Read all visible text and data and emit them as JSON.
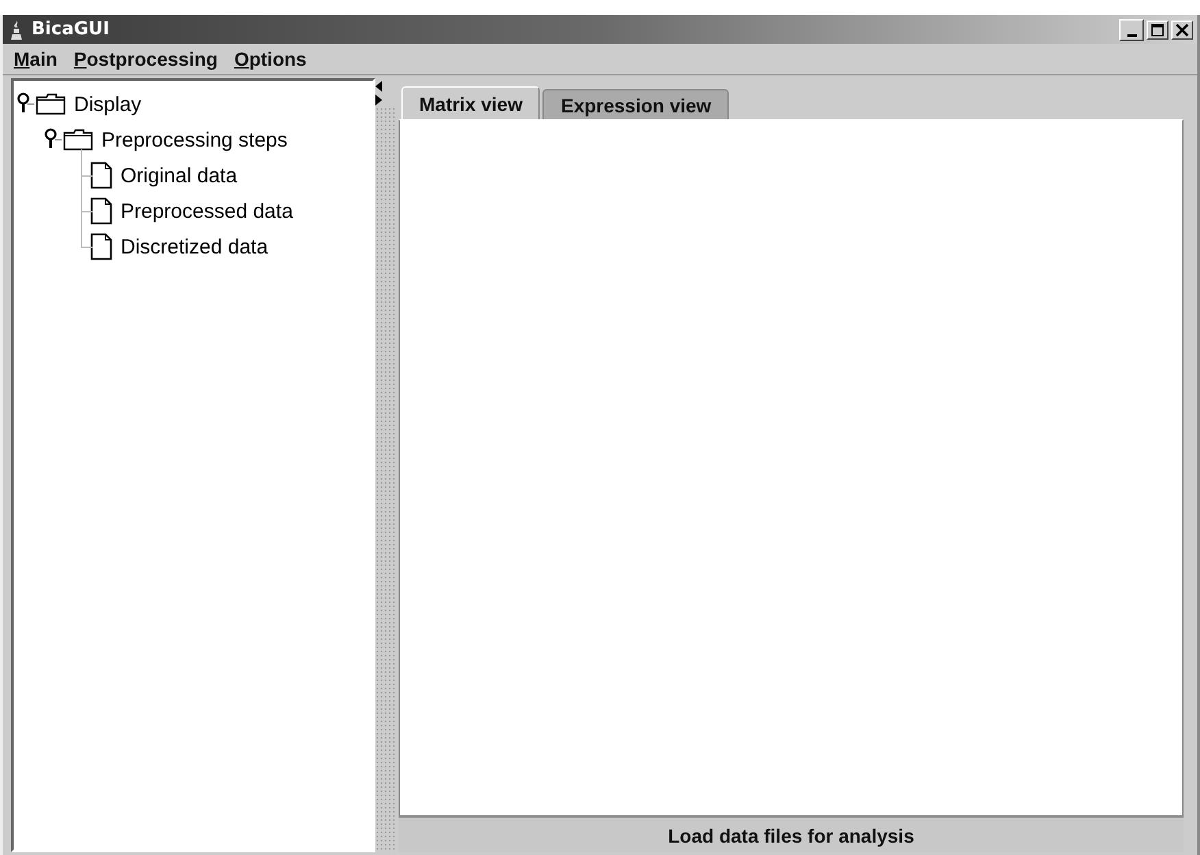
{
  "window": {
    "title": "BicaGUI"
  },
  "menu": [
    "Main",
    "Postprocessing",
    "Options"
  ],
  "tree": [
    {
      "label": "Display",
      "kind": "folder",
      "expanded": true,
      "children": [
        {
          "label": "Preprocessing steps",
          "kind": "folder",
          "expanded": true,
          "children": [
            {
              "label": "Original data",
              "kind": "file"
            },
            {
              "label": "Preprocessed data",
              "kind": "file"
            },
            {
              "label": "Discretized data",
              "kind": "file"
            }
          ]
        }
      ]
    }
  ],
  "tabs": [
    {
      "label": "Matrix view",
      "selected": true
    },
    {
      "label": "Expression view",
      "selected": false
    }
  ],
  "status_bar": "Load data files for analysis"
}
